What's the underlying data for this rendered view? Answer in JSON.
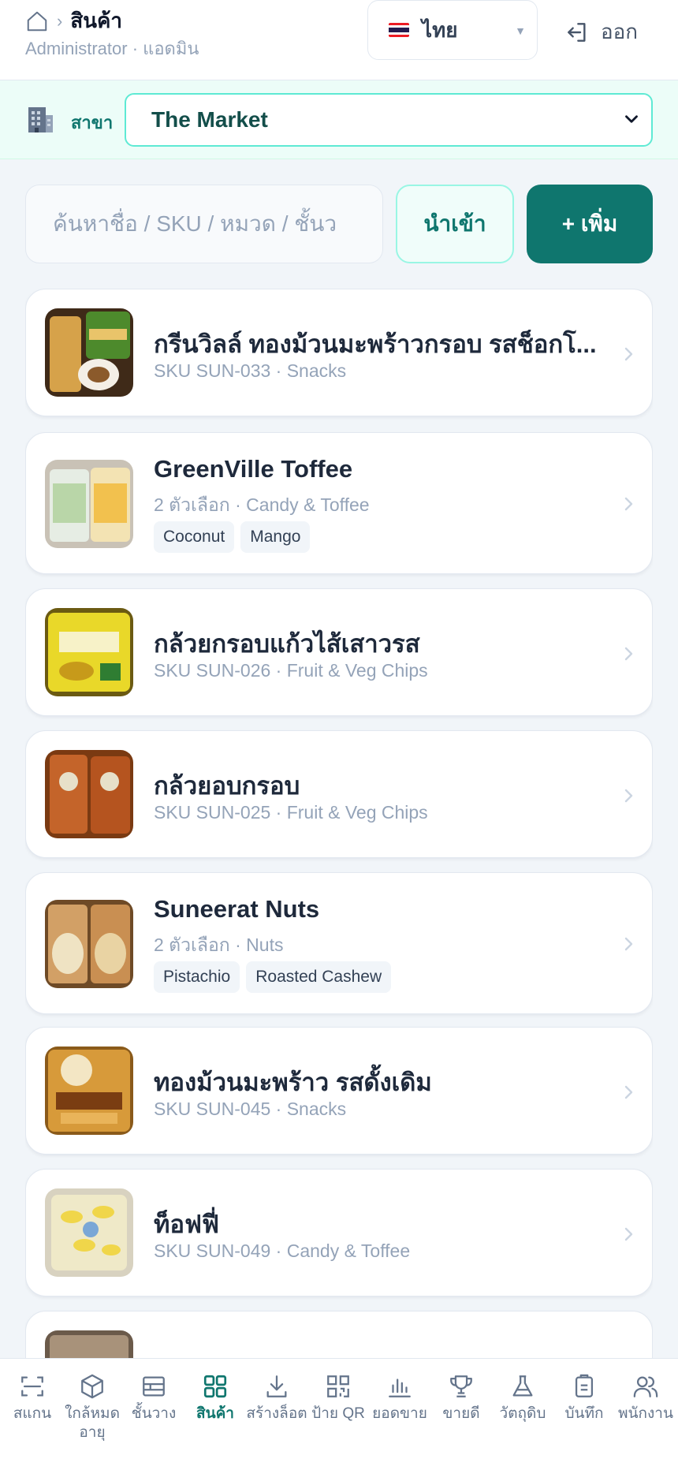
{
  "header": {
    "title": "สินค้า",
    "role": "Administrator · แอดมิน",
    "language": "ไทย",
    "logout_label": "ออก"
  },
  "branch": {
    "label": "สาขา",
    "selected": "The Market"
  },
  "toolbar": {
    "search_placeholder": "ค้นหาชื่อ / SKU / หมวด / ชั้นว",
    "import_label": "นำเข้า",
    "add_label": "+ เพิ่ม"
  },
  "products": [
    {
      "name": "กรีนวิลล์ ทองม้วนมะพร้าวกรอบ รสช็อกโ...",
      "meta": "SKU SUN-033 · Snacks",
      "tags": []
    },
    {
      "name": "GreenVille Toffee",
      "meta": "2 ตัวเลือก · Candy & Toffee",
      "tags": [
        "Coconut",
        "Mango"
      ]
    },
    {
      "name": "กล้วยกรอบแก้วไส้เสาวรส",
      "meta": "SKU SUN-026 · Fruit & Veg Chips",
      "tags": []
    },
    {
      "name": "กล้วยอบกรอบ",
      "meta": "SKU SUN-025 · Fruit & Veg Chips",
      "tags": []
    },
    {
      "name": "Suneerat Nuts",
      "meta": "2 ตัวเลือก · Nuts",
      "tags": [
        "Pistachio",
        "Roasted Cashew"
      ]
    },
    {
      "name": "ทองม้วนมะพร้าว รสดั้งเดิม",
      "meta": "SKU SUN-045 · Snacks",
      "tags": []
    },
    {
      "name": "ท็อฟฟี่",
      "meta": "SKU SUN-049 · Candy & Toffee",
      "tags": []
    }
  ],
  "nav": [
    {
      "label": "สแกน",
      "icon": "scan-icon"
    },
    {
      "label": "ใกล้หมด อายุ",
      "icon": "box-icon"
    },
    {
      "label": "ชั้นวาง",
      "icon": "shelf-icon"
    },
    {
      "label": "สินค้า",
      "icon": "grid-icon",
      "active": true
    },
    {
      "label": "สร้างล็อต",
      "icon": "download-icon"
    },
    {
      "label": "ป้าย QR",
      "icon": "qr-icon"
    },
    {
      "label": "ยอดขาย",
      "icon": "bar-chart-icon"
    },
    {
      "label": "ขายดี",
      "icon": "trophy-icon"
    },
    {
      "label": "วัตถุดิบ",
      "icon": "flask-icon"
    },
    {
      "label": "บันทึก",
      "icon": "clipboard-icon"
    },
    {
      "label": "พนักงาน",
      "icon": "users-icon"
    }
  ],
  "colors": {
    "accent": "#0f766e",
    "accent_light": "#f0fdfa",
    "branch_bg": "#ecfdf8"
  }
}
